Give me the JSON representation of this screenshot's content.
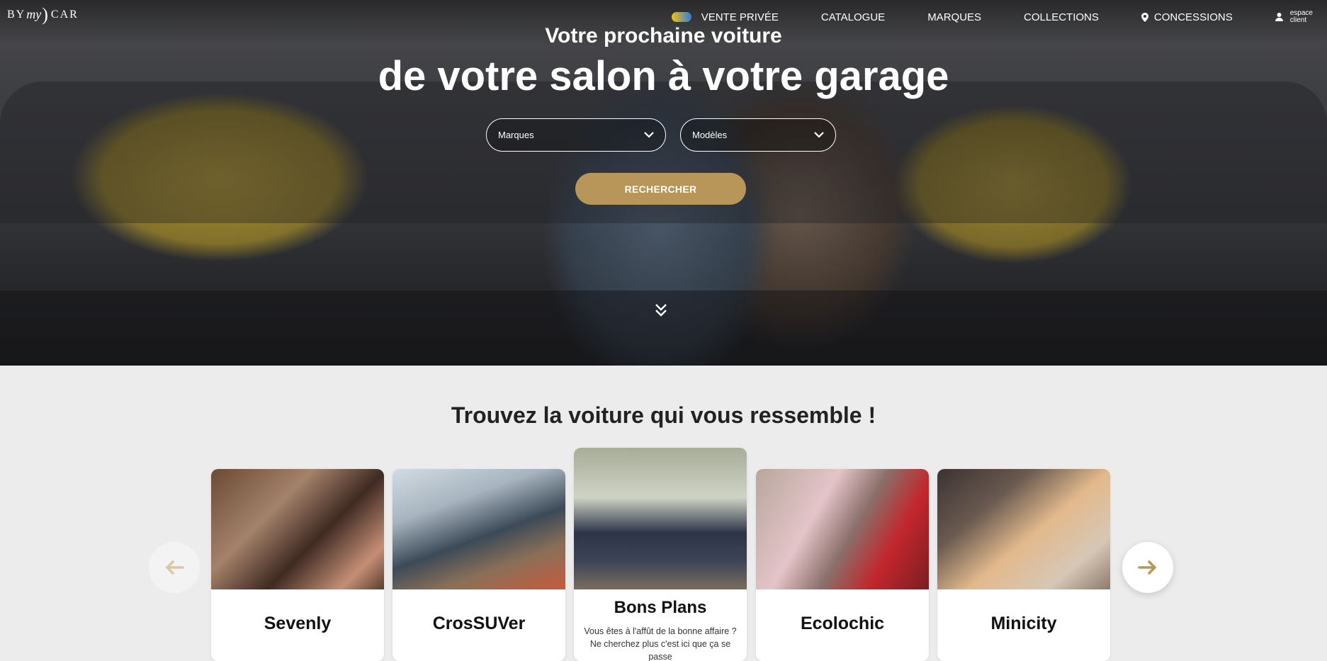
{
  "header": {
    "logo": {
      "by": "BY",
      "my": "my",
      "paren": ")",
      "car": "CAR"
    },
    "nav": [
      {
        "label": "VENTE PRIVÉE",
        "icon": "vente-privee-badge-icon"
      },
      {
        "label": "CATALOGUE"
      },
      {
        "label": "MARQUES"
      },
      {
        "label": "COLLECTIONS"
      },
      {
        "label": "CONCESSIONS",
        "icon": "location-pin-icon"
      }
    ],
    "account": {
      "line1": "espace",
      "line2": "client",
      "icon": "user-icon"
    }
  },
  "hero": {
    "subtitle": "Votre prochaine voiture",
    "title": "de votre salon à votre garage",
    "brand_select": "Marques",
    "model_select": "Modèles",
    "search_label": "RECHERCHER",
    "scroll_icon": "double-chevron-down-icon"
  },
  "collections": {
    "title": "Trouvez la voiture qui vous ressemble !",
    "cards": [
      {
        "name": "Sevenly"
      },
      {
        "name": "CrosSUVer"
      },
      {
        "name": "Bons Plans",
        "description": "Vous êtes à l'affût de la bonne affaire ? Ne cherchez plus c'est ici que ça se passe"
      },
      {
        "name": "Ecolochic"
      },
      {
        "name": "Minicity"
      }
    ],
    "prev_icon": "arrow-left-icon",
    "next_icon": "arrow-right-icon"
  },
  "colors": {
    "accent": "#b8965a",
    "background": "#ececec"
  }
}
